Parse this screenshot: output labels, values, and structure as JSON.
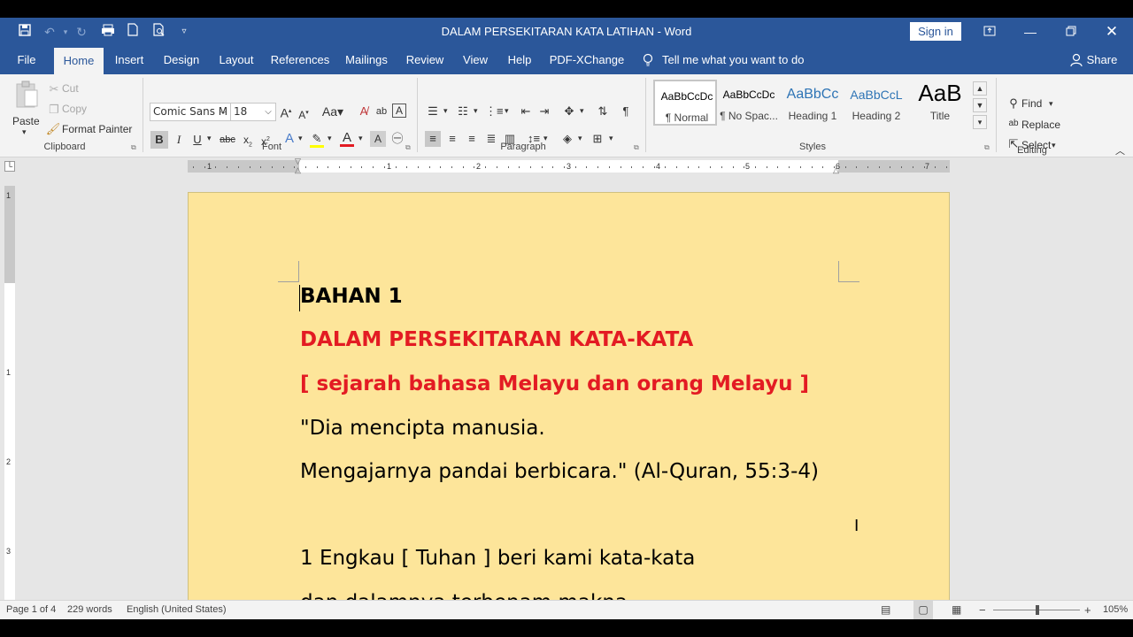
{
  "window": {
    "title": "DALAM PERSEKITARAN KATA LATIHAN  -  Word",
    "sign_in": "Sign in"
  },
  "tabs": [
    "File",
    "Home",
    "Insert",
    "Design",
    "Layout",
    "References",
    "Mailings",
    "Review",
    "View",
    "Help",
    "PDF-XChange"
  ],
  "tell_me": "Tell me what you want to do",
  "share": "Share",
  "clipboard": {
    "paste": "Paste",
    "cut": "Cut",
    "copy": "Copy",
    "format_painter": "Format Painter",
    "label": "Clipboard"
  },
  "font": {
    "name": "Comic Sans M",
    "size": "18",
    "label": "Font"
  },
  "paragraph": {
    "label": "Paragraph"
  },
  "styles": {
    "items": [
      {
        "preview": "AaBbCcDc",
        "name": "¶ Normal"
      },
      {
        "preview": "AaBbCcDc",
        "name": "¶ No Spac..."
      },
      {
        "preview": "AaBbCc",
        "name": "Heading 1"
      },
      {
        "preview": "AaBbCcL",
        "name": "Heading 2"
      },
      {
        "preview": "AaB",
        "name": "Title"
      }
    ],
    "label": "Styles"
  },
  "editing": {
    "find": "Find",
    "replace": "Replace",
    "select": "Select",
    "label": "Editing"
  },
  "ruler": {
    "numbers": [
      "1",
      "1",
      "2",
      "3",
      "4",
      "5",
      "6",
      "7"
    ],
    "vnumbers": [
      "1",
      "1",
      "2",
      "3"
    ]
  },
  "document": {
    "lines": [
      "BAHAN 1",
      "DALAM PERSEKITARAN KATA-KATA",
      "[ sejarah bahasa Melayu dan orang Melayu ]",
      "\"Dia mencipta manusia.",
      "Mengajarnya pandai berbicara.\" (Al-Quran, 55:3-4)",
      "1 Engkau [ Tuhan ]  beri kami kata-kata",
      "dan dalamnya terbenam makna"
    ],
    "colors": {
      "page": "#fde59a",
      "accent_red": "#e31b23"
    }
  },
  "status": {
    "page": "Page 1 of 4",
    "words": "229 words",
    "language": "English (United States)",
    "zoom": "105%",
    "zoom_minus": "−",
    "zoom_plus": "+"
  },
  "colors": {
    "brand": "#2b579a",
    "ribbon": "#f3f3f3"
  }
}
